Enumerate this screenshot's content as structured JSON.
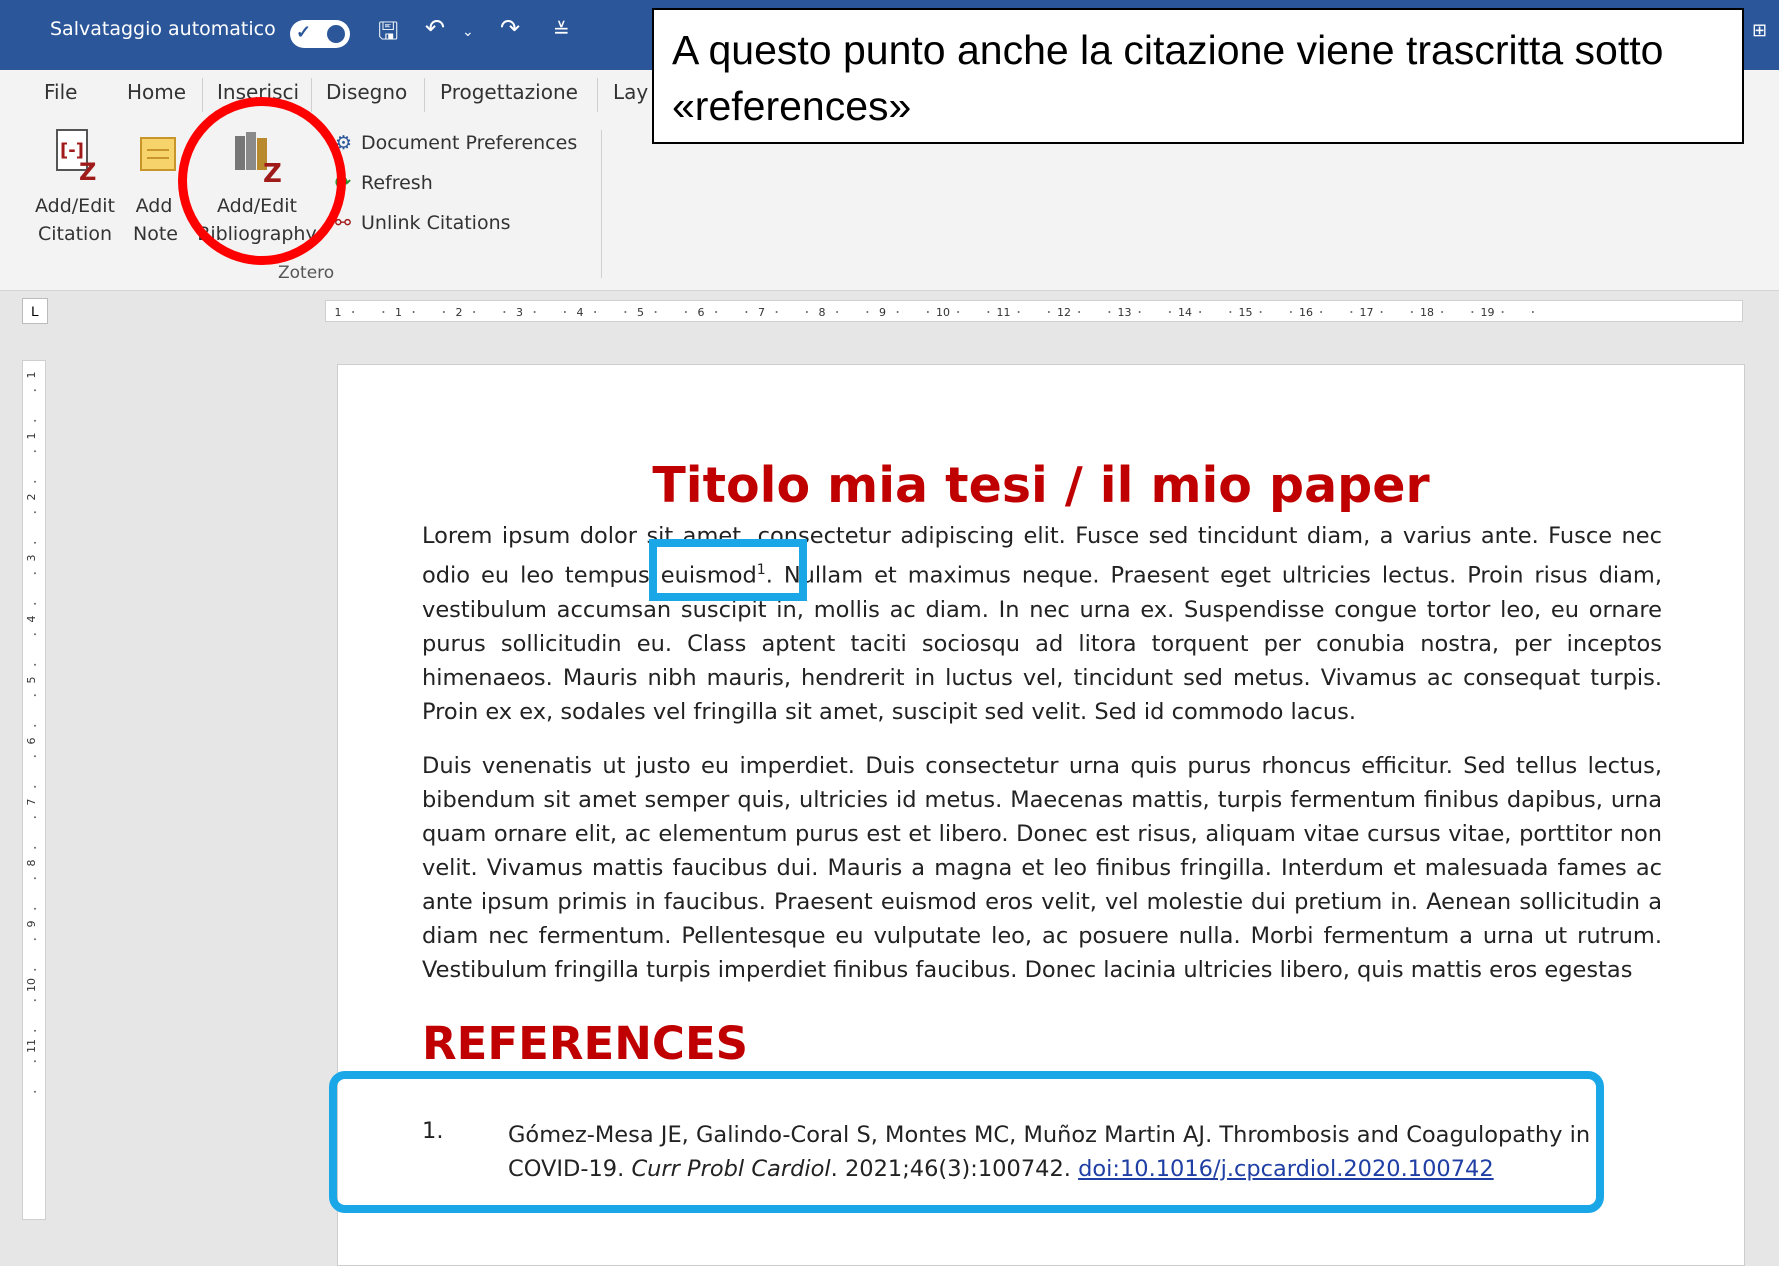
{
  "titlebar": {
    "autosave_label": "Salvataggio automatico",
    "autosave_on": true
  },
  "tabs": [
    "File",
    "Home",
    "Inserisci",
    "Disegno",
    "Progettazione",
    "Lay"
  ],
  "ribbon": {
    "add_edit_citation": "Add/Edit Citation",
    "add_note": "Add Note",
    "add_edit_bibliography": "Add/Edit Bibliography",
    "document_preferences": "Document Preferences",
    "refresh": "Refresh",
    "unlink_citations": "Unlink Citations",
    "group_label": "Zotero"
  },
  "callout": {
    "text": "A questo punto anche la citazione viene trascritta sotto «references»"
  },
  "document": {
    "title": "Titolo mia tesi / il mio paper",
    "para1_before": "Lorem ipsum dolor sit amet, consectetur adipiscing elit. Fusce sed tincidunt diam, a varius ante. Fusce nec odio eu leo tempus euismod",
    "para1_citation_mark": "1",
    "para1_after": ". Nullam et maximus neque. Praesent eget ultricies lectus. Proin risus diam, vestibulum accumsan suscipit in, mollis ac diam. In nec urna ex. Suspendisse congue tortor leo, eu ornare purus sollicitudin eu. Class aptent taciti sociosqu ad litora torquent per conubia nostra, per inceptos himenaeos. Mauris nibh mauris, hendrerit in luctus vel, tincidunt sed metus. Vivamus ac consequat turpis. Proin ex ex, sodales vel fringilla sit amet, suscipit sed velit. Sed id commodo lacus.",
    "para2": "Duis venenatis ut justo eu imperdiet. Duis consectetur urna quis purus rhoncus efficitur. Sed tellus lectus, bibendum sit amet semper quis, ultricies id metus. Maecenas mattis, turpis fermentum finibus dapibus, urna quam ornare elit, ac elementum purus est et libero. Donec est risus, aliquam vitae cursus vitae, porttitor non velit. Vivamus mattis faucibus dui. Mauris a magna et leo finibus fringilla. Interdum et malesuada fames ac ante ipsum primis in faucibus. Praesent euismod eros velit, vel molestie dui pretium in. Aenean sollicitudin a diam nec fermentum. Pellentesque eu vulputate leo, ac posuere nulla. Morbi fermentum a urna ut rutrum. Vestibulum fringilla turpis imperdiet finibus faucibus. Donec lacinia ultricies libero, quis mattis eros egestas",
    "references_heading": "REFERENCES",
    "reference": {
      "number": "1.",
      "authors_title": "Gómez-Mesa JE, Galindo-Coral S, Montes MC, Muñoz Martin AJ. Thrombosis and Coagulopathy in COVID-19. ",
      "journal": "Curr Probl Cardiol",
      "details": ". 2021;46(3):100742. ",
      "doi": "doi:10.1016/j.cpcardiol.2020.100742"
    }
  },
  "ruler": {
    "h_labels": [
      "1",
      "1",
      "2",
      "3",
      "4",
      "5",
      "6",
      "7",
      "8",
      "9",
      "10",
      "11",
      "12",
      "13",
      "14",
      "15",
      "16",
      "17",
      "18",
      "19"
    ],
    "v_labels": [
      "1",
      "1",
      "2",
      "3",
      "4",
      "5",
      "6",
      "7",
      "8",
      "9",
      "10",
      "11"
    ]
  },
  "annotations": {
    "circle_color": "#ff0000",
    "box_color": "#1aa7e8"
  }
}
